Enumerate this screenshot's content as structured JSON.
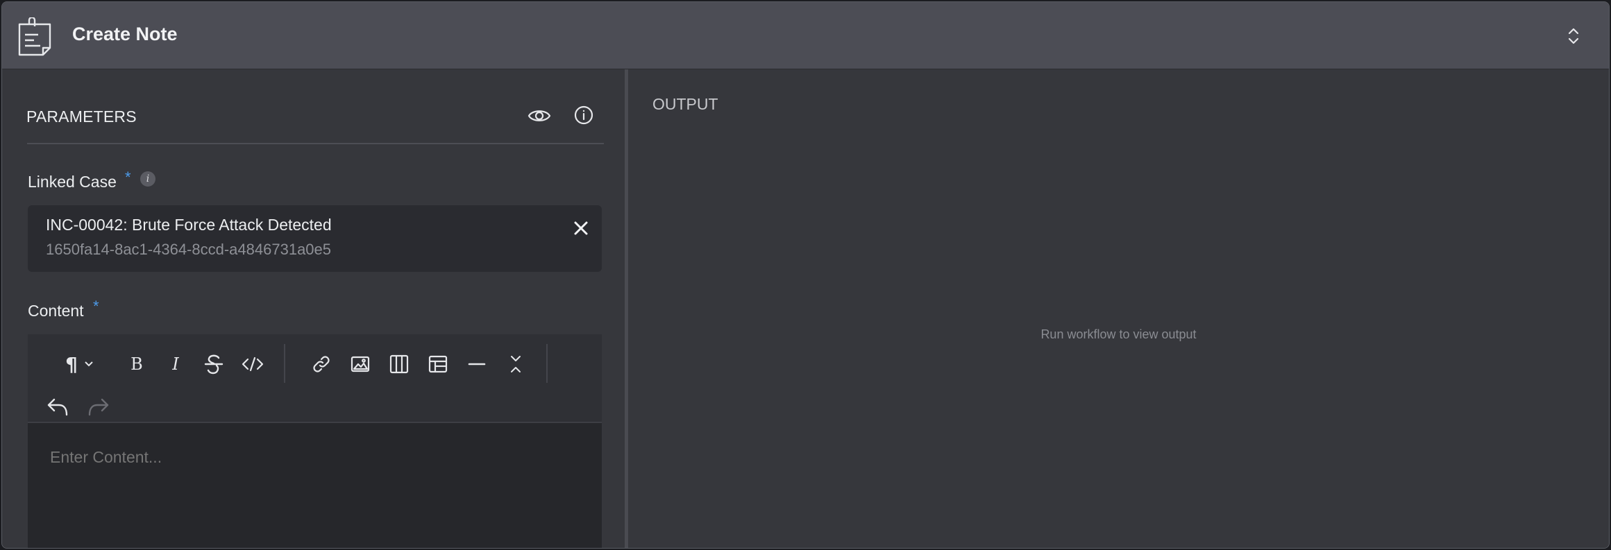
{
  "header": {
    "title": "Create Note"
  },
  "parameters": {
    "heading": "PARAMETERS"
  },
  "linked_case": {
    "label": "Linked Case",
    "required_mark": "*",
    "info_glyph": "i",
    "value_title": "INC-00042: Brute Force Attack Detected",
    "value_id": "1650fa14-8ac1-4364-8ccd-a4846731a0e5"
  },
  "content": {
    "label": "Content",
    "required_mark": "*",
    "placeholder": "Enter Content..."
  },
  "toolbar": {
    "buttons": [
      "paragraph-icon",
      "bold-icon",
      "italic-icon",
      "strikethrough-icon",
      "code-icon",
      "link-icon",
      "image-icon",
      "columns-icon",
      "table-icon",
      "horizontal-rule-icon",
      "collapse-icon",
      "undo-icon",
      "redo-icon"
    ],
    "paragraph_glyph": "¶",
    "bold_glyph": "B",
    "italic_glyph": "I"
  },
  "output": {
    "heading": "OUTPUT",
    "empty_message": "Run workflow to view output"
  },
  "colors": {
    "accent": "#4d9bea",
    "header_bg": "#4c4d55",
    "panel_bg": "#36373c",
    "field_bg": "#2a2b30"
  }
}
